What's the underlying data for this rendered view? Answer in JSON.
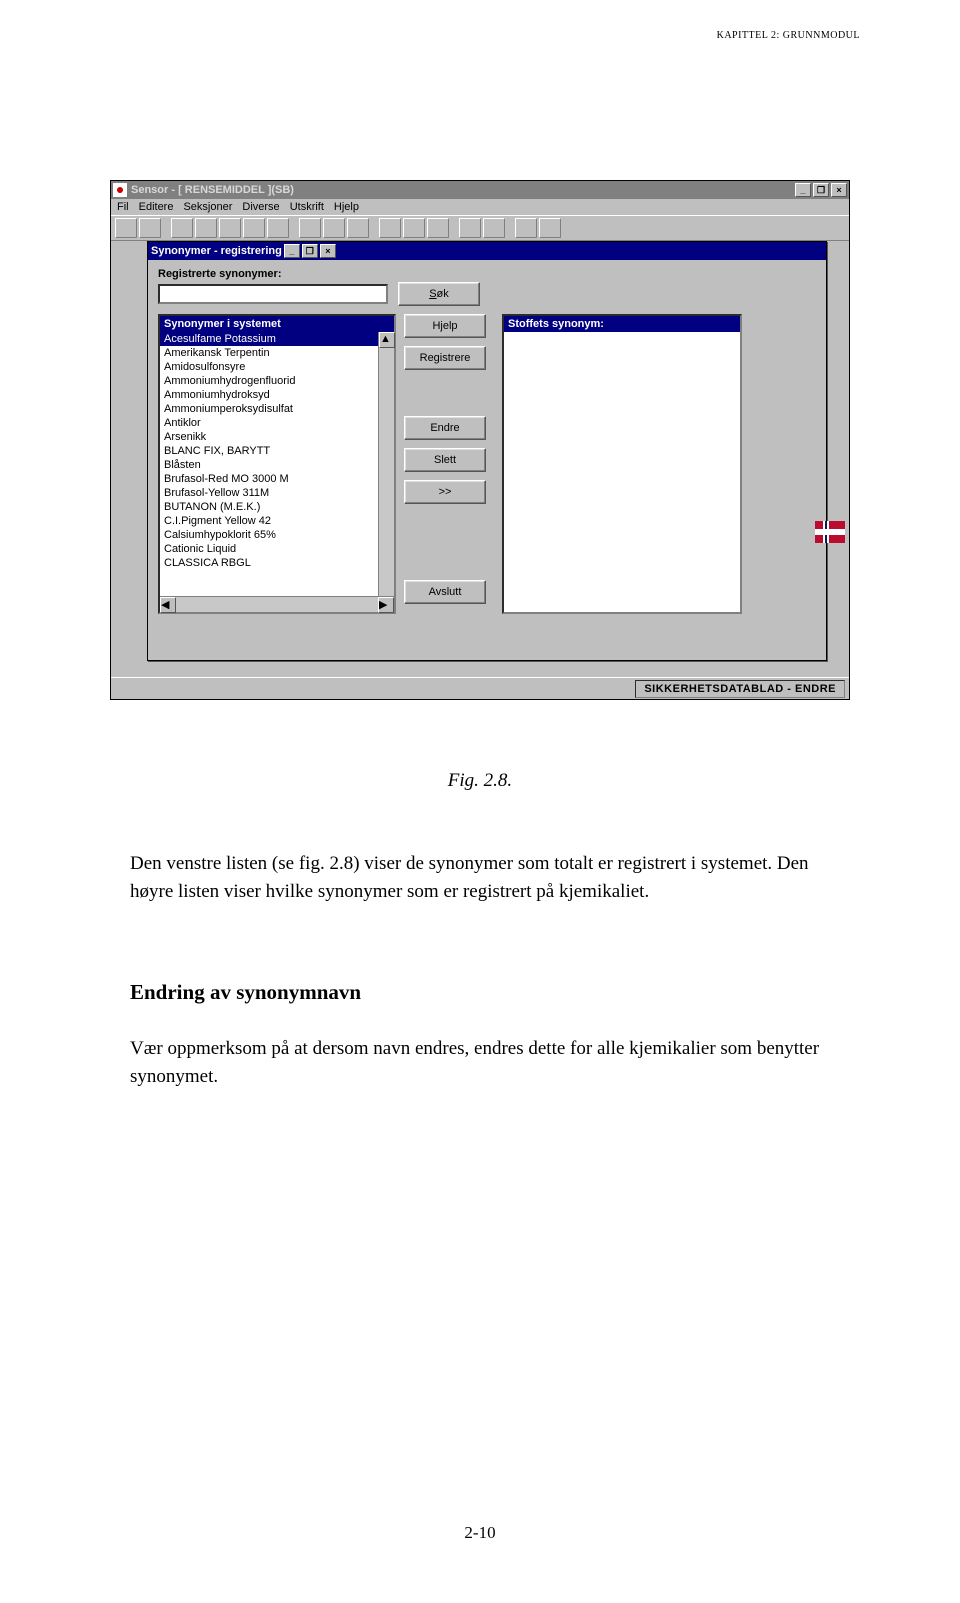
{
  "page_header": "KAPITTEL 2: GRUNNMODUL",
  "fig_caption": "Fig. 2.8.",
  "para1": "Den venstre listen (se fig. 2.8) viser de synonymer som totalt er registrert i systemet. Den høyre listen viser hvilke synonymer som er registrert på kjemikaliet.",
  "heading_endring": "Endring av synonymnavn",
  "para2": "Vær oppmerksom på at dersom navn endres, endres dette for alle kjemikalier som benytter synonymet.",
  "page_number": "2-10",
  "outer_window": {
    "title": "Sensor - [ RENSEMIDDEL ](SB)",
    "menu": [
      "Fil",
      "Editere",
      "Seksjoner",
      "Diverse",
      "Utskrift",
      "Hjelp"
    ],
    "statusbar": "SIKKERHETSDATABLAD - ENDRE"
  },
  "inner_dialog": {
    "title": "Synonymer - registrering",
    "label_reg": "Registrerte synonymer:",
    "search_value": "",
    "left_header": "Synonymer i systemet",
    "left_items": [
      "Acesulfame Potassium",
      "Amerikansk Terpentin",
      "Amidosulfonsyre",
      "Ammoniumhydrogenfluorid",
      "Ammoniumhydroksyd",
      "Ammoniumperoksydisulfat",
      "Antiklor",
      "Arsenikk",
      "BLANC FIX, BARYTT",
      "Blåsten",
      "Brufasol-Red MO 3000 M",
      "Brufasol-Yellow 311M",
      "BUTANON (M.E.K.)",
      "C.I.Pigment Yellow 42",
      "Calsiumhypoklorit 65%",
      "Cationic Liquid",
      "CLASSICA RBGL"
    ],
    "right_header": "Stoffets synonym:",
    "buttons": {
      "sok": "Søk",
      "hjelp": "Hjelp",
      "registrere": "Registrere",
      "endre": "Endre",
      "slett": "Slett",
      "move": ">>",
      "avslutt": "Avslutt"
    }
  }
}
